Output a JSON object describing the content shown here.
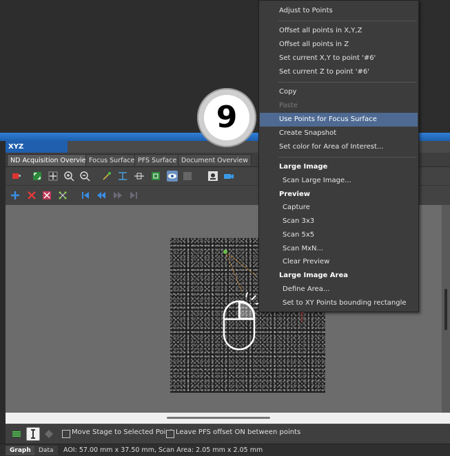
{
  "panel": {
    "title": "XYZ Overview",
    "close_glyph": "×",
    "tabs": [
      "ND Acquisition Overview",
      "Focus Surface",
      "PFS Surface",
      "Document Overview"
    ],
    "active_tab": 0
  },
  "options": {
    "move_stage_label": "Move Stage to Selected Point",
    "leave_pfs_label": "Leave PFS offset ON between points"
  },
  "status": {
    "tabs": [
      "Graph",
      "Data"
    ],
    "text": "AOI: 57.00 mm x 37.50 mm, Scan Area: 2.05 mm x 2.05 mm"
  },
  "badge": {
    "number": "9"
  },
  "menu": {
    "items": [
      "Adjust to Points",
      "Offset all points in X,Y,Z",
      "Offset all points in Z",
      "Set current X,Y to point '#6'",
      "Set current Z to point '#6'",
      "Copy",
      "Paste",
      "Use Points for Focus Surface",
      "Create Snapshot",
      "Set color for Area of Interest...",
      "Large Image",
      "Scan Large Image...",
      "Preview",
      "Capture",
      "Scan 3x3",
      "Scan 5x5",
      "Scan MxN...",
      "Clear Preview",
      "Large Image Area",
      "Define Area...",
      "Set to XY Points bounding rectangle"
    ],
    "highlighted_item": "Use Points for Focus Surface",
    "disabled_items": [
      "Paste"
    ]
  },
  "colors": {
    "accent_blue": "#1f5fae",
    "menu_highlight": "#4e6a92",
    "add_icon": "#3a8ee6",
    "delete_icon": "#e03a3a"
  }
}
